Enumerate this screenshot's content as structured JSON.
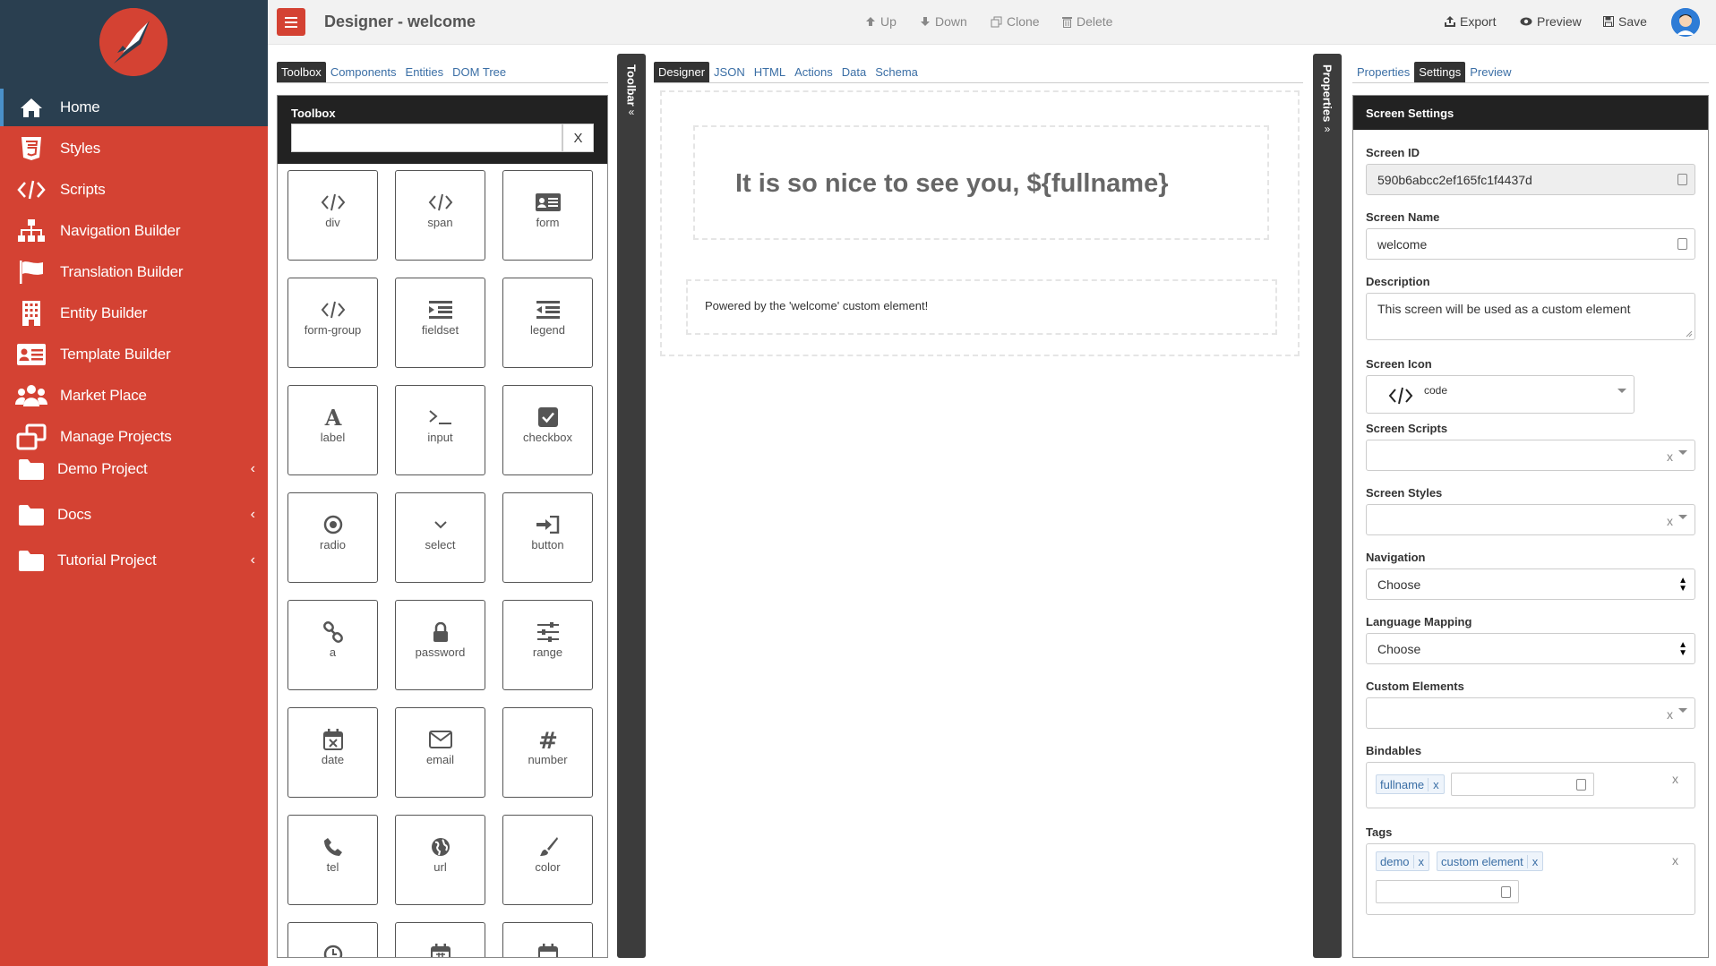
{
  "sidebar": {
    "items": [
      {
        "label": "Home",
        "icon": "home-icon"
      },
      {
        "label": "Styles",
        "icon": "css3-icon"
      },
      {
        "label": "Scripts",
        "icon": "code-icon"
      },
      {
        "label": "Navigation Builder",
        "icon": "sitemap-icon"
      },
      {
        "label": "Translation Builder",
        "icon": "flag-icon"
      },
      {
        "label": "Entity Builder",
        "icon": "building-icon"
      },
      {
        "label": "Template Builder",
        "icon": "id-card-icon"
      },
      {
        "label": "Market Place",
        "icon": "users-icon"
      },
      {
        "label": "Manage Projects",
        "icon": "clone-icon"
      },
      {
        "label": "Demo Project",
        "icon": "folder-icon"
      },
      {
        "label": "Docs",
        "icon": "folder-icon"
      },
      {
        "label": "Tutorial Project",
        "icon": "folder-icon"
      }
    ]
  },
  "topbar": {
    "title": "Designer - welcome",
    "up": "Up",
    "down": "Down",
    "clone": "Clone",
    "delete": "Delete",
    "export": "Export",
    "preview": "Preview",
    "save": "Save"
  },
  "left_tabs": [
    "Toolbox",
    "Components",
    "Entities",
    "DOM Tree"
  ],
  "toolbox": {
    "title": "Toolbox",
    "search_value": "",
    "clear_label": "X",
    "items": [
      "div",
      "span",
      "form",
      "form-group",
      "fieldset",
      "legend",
      "label",
      "input",
      "checkbox",
      "radio",
      "select",
      "button",
      "a",
      "password",
      "range",
      "date",
      "email",
      "number",
      "tel",
      "url",
      "color"
    ]
  },
  "toolbar_vertical": "Toolbar",
  "properties_vertical": "Properties",
  "center_tabs": [
    "Designer",
    "JSON",
    "HTML",
    "Actions",
    "Data",
    "Schema"
  ],
  "designer": {
    "heading": "It is so nice to see you, ${fullname}",
    "powered": "Powered by the 'welcome' custom element!"
  },
  "right_tabs": [
    "Properties",
    "Settings",
    "Preview"
  ],
  "settings": {
    "title": "Screen Settings",
    "screen_id_label": "Screen ID",
    "screen_id": "590b6abcc2ef165fc1f4437d",
    "screen_name_label": "Screen Name",
    "screen_name": "welcome",
    "description_label": "Description",
    "description": "This screen will be used as a custom element",
    "screen_icon_label": "Screen Icon",
    "screen_icon": "code",
    "screen_scripts_label": "Screen Scripts",
    "screen_styles_label": "Screen Styles",
    "navigation_label": "Navigation",
    "navigation_value": "Choose",
    "language_mapping_label": "Language Mapping",
    "language_mapping_value": "Choose",
    "custom_elements_label": "Custom Elements",
    "bindables_label": "Bindables",
    "bindables": [
      "fullname"
    ],
    "tags_label": "Tags",
    "tags": [
      "demo",
      "custom element"
    ],
    "clear_x": "x",
    "remove_x": "x"
  },
  "colors": {
    "sidebar": "#d44233",
    "sidebar_dark": "#2a3f50",
    "panel_head": "#222222",
    "link": "#3a6ea5"
  }
}
